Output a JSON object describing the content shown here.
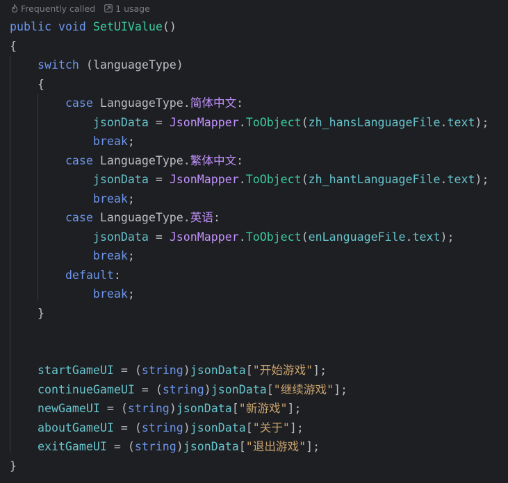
{
  "inlay_hints": {
    "frequently_called": "Frequently called",
    "usages": "1 usage"
  },
  "code_lines": [
    [
      {
        "c": "kwb",
        "t": "public"
      },
      {
        "c": "tx",
        "t": " "
      },
      {
        "c": "kwb",
        "t": "void"
      },
      {
        "c": "tx",
        "t": " "
      },
      {
        "c": "fn",
        "t": "SetUIValue"
      },
      {
        "c": "tx",
        "t": "()"
      }
    ],
    [
      {
        "c": "tx",
        "t": "{"
      }
    ],
    [
      {
        "c": "tx",
        "t": "    "
      },
      {
        "c": "kwb",
        "t": "switch"
      },
      {
        "c": "tx",
        "t": " ("
      },
      {
        "c": "tx",
        "t": "languageType"
      },
      {
        "c": "tx",
        "t": ")"
      }
    ],
    [
      {
        "c": "tx",
        "t": "    {"
      }
    ],
    [
      {
        "c": "tx",
        "t": "        "
      },
      {
        "c": "kwb",
        "t": "case"
      },
      {
        "c": "tx",
        "t": " "
      },
      {
        "c": "tx",
        "t": "LanguageType"
      },
      {
        "c": "tx",
        "t": "."
      },
      {
        "c": "ty",
        "t": "简体中文"
      },
      {
        "c": "tx",
        "t": ":"
      }
    ],
    [
      {
        "c": "tx",
        "t": "            "
      },
      {
        "c": "va",
        "t": "jsonData"
      },
      {
        "c": "tx",
        "t": " = "
      },
      {
        "c": "ty",
        "t": "JsonMapper"
      },
      {
        "c": "tx",
        "t": "."
      },
      {
        "c": "fn",
        "t": "ToObject"
      },
      {
        "c": "tx",
        "t": "("
      },
      {
        "c": "va",
        "t": "zh_hansLanguageFile"
      },
      {
        "c": "tx",
        "t": "."
      },
      {
        "c": "va",
        "t": "text"
      },
      {
        "c": "tx",
        "t": ");"
      }
    ],
    [
      {
        "c": "tx",
        "t": "            "
      },
      {
        "c": "kwb",
        "t": "break"
      },
      {
        "c": "tx",
        "t": ";"
      }
    ],
    [
      {
        "c": "tx",
        "t": "        "
      },
      {
        "c": "kwb",
        "t": "case"
      },
      {
        "c": "tx",
        "t": " "
      },
      {
        "c": "tx",
        "t": "LanguageType"
      },
      {
        "c": "tx",
        "t": "."
      },
      {
        "c": "ty",
        "t": "繁体中文"
      },
      {
        "c": "tx",
        "t": ":"
      }
    ],
    [
      {
        "c": "tx",
        "t": "            "
      },
      {
        "c": "va",
        "t": "jsonData"
      },
      {
        "c": "tx",
        "t": " = "
      },
      {
        "c": "ty",
        "t": "JsonMapper"
      },
      {
        "c": "tx",
        "t": "."
      },
      {
        "c": "fn",
        "t": "ToObject"
      },
      {
        "c": "tx",
        "t": "("
      },
      {
        "c": "va",
        "t": "zh_hantLanguageFile"
      },
      {
        "c": "tx",
        "t": "."
      },
      {
        "c": "va",
        "t": "text"
      },
      {
        "c": "tx",
        "t": ");"
      }
    ],
    [
      {
        "c": "tx",
        "t": "            "
      },
      {
        "c": "kwb",
        "t": "break"
      },
      {
        "c": "tx",
        "t": ";"
      }
    ],
    [
      {
        "c": "tx",
        "t": "        "
      },
      {
        "c": "kwb",
        "t": "case"
      },
      {
        "c": "tx",
        "t": " "
      },
      {
        "c": "tx",
        "t": "LanguageType"
      },
      {
        "c": "tx",
        "t": "."
      },
      {
        "c": "ty",
        "t": "英语"
      },
      {
        "c": "tx",
        "t": ":"
      }
    ],
    [
      {
        "c": "tx",
        "t": "            "
      },
      {
        "c": "va",
        "t": "jsonData"
      },
      {
        "c": "tx",
        "t": " = "
      },
      {
        "c": "ty",
        "t": "JsonMapper"
      },
      {
        "c": "tx",
        "t": "."
      },
      {
        "c": "fn",
        "t": "ToObject"
      },
      {
        "c": "tx",
        "t": "("
      },
      {
        "c": "va",
        "t": "enLanguageFile"
      },
      {
        "c": "tx",
        "t": "."
      },
      {
        "c": "va",
        "t": "text"
      },
      {
        "c": "tx",
        "t": ");"
      }
    ],
    [
      {
        "c": "tx",
        "t": "            "
      },
      {
        "c": "kwb",
        "t": "break"
      },
      {
        "c": "tx",
        "t": ";"
      }
    ],
    [
      {
        "c": "tx",
        "t": "        "
      },
      {
        "c": "kwb",
        "t": "default"
      },
      {
        "c": "tx",
        "t": ":"
      }
    ],
    [
      {
        "c": "tx",
        "t": "            "
      },
      {
        "c": "kwb",
        "t": "break"
      },
      {
        "c": "tx",
        "t": ";"
      }
    ],
    [
      {
        "c": "tx",
        "t": "    }"
      }
    ],
    [
      {
        "c": "tx",
        "t": ""
      }
    ],
    [
      {
        "c": "tx",
        "t": ""
      }
    ],
    [
      {
        "c": "tx",
        "t": "    "
      },
      {
        "c": "va",
        "t": "startGameUI"
      },
      {
        "c": "tx",
        "t": " = ("
      },
      {
        "c": "kwb",
        "t": "string"
      },
      {
        "c": "tx",
        "t": ")"
      },
      {
        "c": "va",
        "t": "jsonData"
      },
      {
        "c": "tx",
        "t": "["
      },
      {
        "c": "st",
        "t": "\"开始游戏\""
      },
      {
        "c": "tx",
        "t": "];"
      }
    ],
    [
      {
        "c": "tx",
        "t": "    "
      },
      {
        "c": "va",
        "t": "continueGameUI"
      },
      {
        "c": "tx",
        "t": " = ("
      },
      {
        "c": "kwb",
        "t": "string"
      },
      {
        "c": "tx",
        "t": ")"
      },
      {
        "c": "va",
        "t": "jsonData"
      },
      {
        "c": "tx",
        "t": "["
      },
      {
        "c": "st",
        "t": "\"继续游戏\""
      },
      {
        "c": "tx",
        "t": "];"
      }
    ],
    [
      {
        "c": "tx",
        "t": "    "
      },
      {
        "c": "va",
        "t": "newGameUI"
      },
      {
        "c": "tx",
        "t": " = ("
      },
      {
        "c": "kwb",
        "t": "string"
      },
      {
        "c": "tx",
        "t": ")"
      },
      {
        "c": "va",
        "t": "jsonData"
      },
      {
        "c": "tx",
        "t": "["
      },
      {
        "c": "st",
        "t": "\"新游戏\""
      },
      {
        "c": "tx",
        "t": "];"
      }
    ],
    [
      {
        "c": "tx",
        "t": "    "
      },
      {
        "c": "va",
        "t": "aboutGameUI"
      },
      {
        "c": "tx",
        "t": " = ("
      },
      {
        "c": "kwb",
        "t": "string"
      },
      {
        "c": "tx",
        "t": ")"
      },
      {
        "c": "va",
        "t": "jsonData"
      },
      {
        "c": "tx",
        "t": "["
      },
      {
        "c": "st",
        "t": "\"关于\""
      },
      {
        "c": "tx",
        "t": "];"
      }
    ],
    [
      {
        "c": "tx",
        "t": "    "
      },
      {
        "c": "va",
        "t": "exitGameUI"
      },
      {
        "c": "tx",
        "t": " = ("
      },
      {
        "c": "kwb",
        "t": "string"
      },
      {
        "c": "tx",
        "t": ")"
      },
      {
        "c": "va",
        "t": "jsonData"
      },
      {
        "c": "tx",
        "t": "["
      },
      {
        "c": "st",
        "t": "\"退出游戏\""
      },
      {
        "c": "tx",
        "t": "];"
      }
    ],
    [
      {
        "c": "tx",
        "t": "}"
      }
    ]
  ],
  "colors": {
    "background": "#1e1f22",
    "keyword": "#6c95eb",
    "method": "#39cc9b",
    "type": "#c191ff",
    "field": "#66c3cc",
    "string": "#c9a26d",
    "plain": "#bcbec4",
    "hint": "#7a7e85",
    "indent_guide": "#393b40"
  },
  "icons": {
    "frequently_called": "flame-icon",
    "usages": "usage-link-icon"
  }
}
